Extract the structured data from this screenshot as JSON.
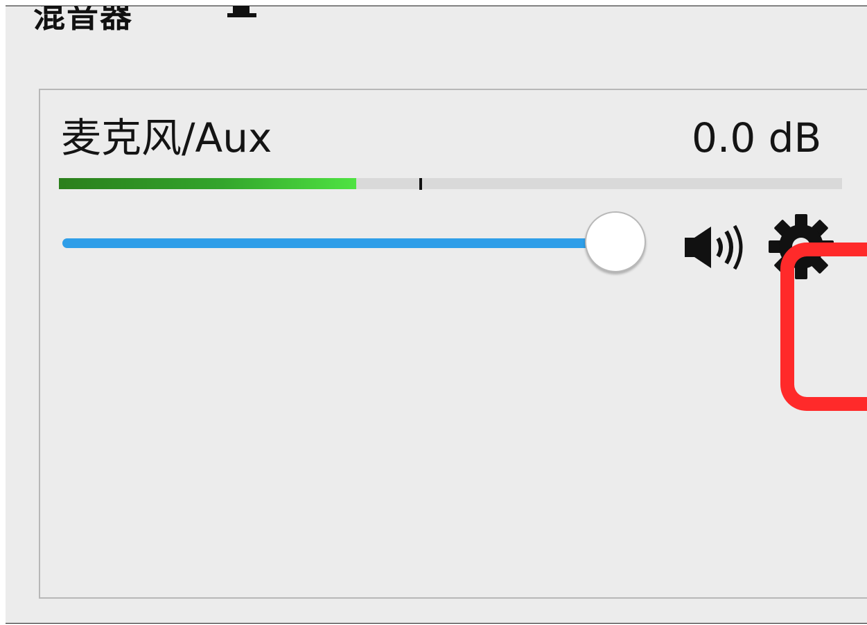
{
  "window": {
    "header_text": "混音器"
  },
  "mixer": {
    "source_name": "麦克风/Aux",
    "volume_db": "0.0 dB",
    "level_meter_fraction": 0.38,
    "peak_marker_fraction": 0.46,
    "volume_slider_fraction": 0.95
  },
  "icons": {
    "mute": "speaker-icon",
    "settings": "gear-icon",
    "header": "mixer-icon"
  },
  "colors": {
    "slider_accent": "#2f9ee8",
    "meter_green_dark": "#2b7f1c",
    "meter_green_light": "#4fe342",
    "highlight": "#ff2a2a",
    "panel_background": "#ececec"
  }
}
